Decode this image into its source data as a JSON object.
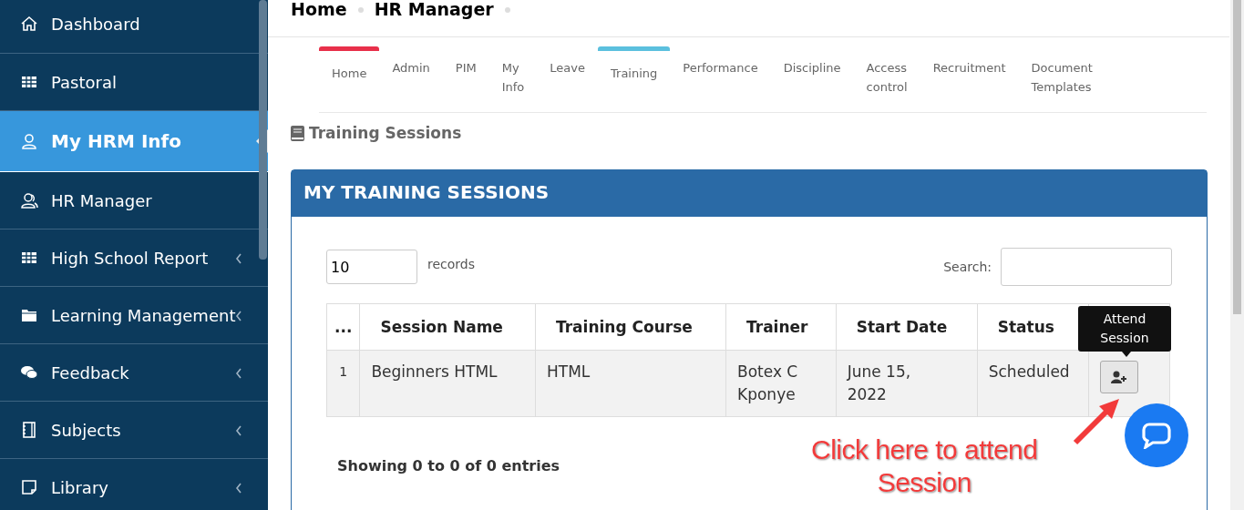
{
  "sidebar": {
    "items": [
      {
        "label": "Dashboard",
        "kind": "home",
        "submenu": false,
        "selected": false
      },
      {
        "label": "Pastoral",
        "kind": "table",
        "submenu": false,
        "selected": false
      },
      {
        "label": "My HRM Info",
        "kind": "user",
        "submenu": false,
        "selected": true
      },
      {
        "label": "HR Manager",
        "kind": "users",
        "submenu": false,
        "selected": false
      },
      {
        "label": "High School Report",
        "kind": "table",
        "submenu": true,
        "selected": false
      },
      {
        "label": "Learning Management",
        "kind": "folder",
        "submenu": true,
        "selected": false
      },
      {
        "label": "Feedback",
        "kind": "comments",
        "submenu": true,
        "selected": false
      },
      {
        "label": "Subjects",
        "kind": "notebook",
        "submenu": true,
        "selected": false
      },
      {
        "label": "Library",
        "kind": "note",
        "submenu": true,
        "selected": false
      }
    ]
  },
  "breadcrumb": [
    "Home",
    "HR Manager"
  ],
  "tabs": [
    {
      "label": "Home",
      "color": "#e8304a"
    },
    {
      "label": "Admin"
    },
    {
      "label": "PIM"
    },
    {
      "label": "My\nInfo"
    },
    {
      "label": "Leave"
    },
    {
      "label": "Training",
      "color": "#5bc0de"
    },
    {
      "label": "Performance"
    },
    {
      "label": "Discipline"
    },
    {
      "label": "Access\ncontrol"
    },
    {
      "label": "Recruitment"
    },
    {
      "label": "Document\nTemplates"
    }
  ],
  "section_title": "Training Sessions",
  "panel": {
    "title": "MY TRAINING SESSIONS",
    "page_length": "10",
    "page_length_label": "records",
    "search_label": "Search:",
    "table": {
      "columns": [
        "...",
        "Session Name",
        "Training Course",
        "Trainer",
        "Start Date",
        "Status"
      ],
      "rows": [
        [
          "1",
          "Beginners HTML",
          "HTML",
          "Botex C\nKponye",
          "June 15,\n2022",
          "Scheduled"
        ]
      ]
    },
    "tooltip": "Attend\nSession",
    "info": "Showing 0 to 0 of 0 entries"
  },
  "annotation": "Click here to attend\nSession"
}
